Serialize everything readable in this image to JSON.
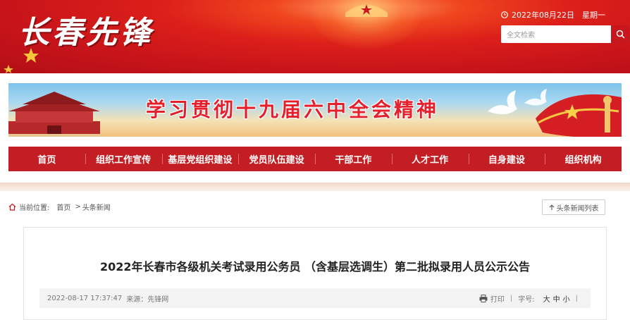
{
  "header": {
    "logo_text": "长春先锋",
    "date": "2022年08月22日",
    "weekday": "星期一",
    "search_placeholder": "全文检索"
  },
  "banner": {
    "slogan": "学习贯彻十九届六中全会精神"
  },
  "nav": {
    "items": [
      "首页",
      "组织工作宣传",
      "基层党组织建设",
      "党员队伍建设",
      "干部工作",
      "人才工作",
      "自身建设",
      "组织机构"
    ]
  },
  "breadcrumb": {
    "label": "当前位置:",
    "home": "首页",
    "separator": ">",
    "current": "头条新闻"
  },
  "list_button": "头条新闻列表",
  "article": {
    "title": "2022年长春市各级机关考试录用公务员 （含基层选调生）第二批拟录用人员公示公告",
    "time": "2022-08-17 17:37:47",
    "source": "来源：先锋网",
    "print_label": "打印",
    "fontsize_label": "字号:",
    "sizes": [
      "大",
      "中",
      "小"
    ]
  },
  "colors": {
    "brand_red": "#c31e23",
    "header_red": "#dc1f1a",
    "slogan_red": "#e4202c"
  }
}
